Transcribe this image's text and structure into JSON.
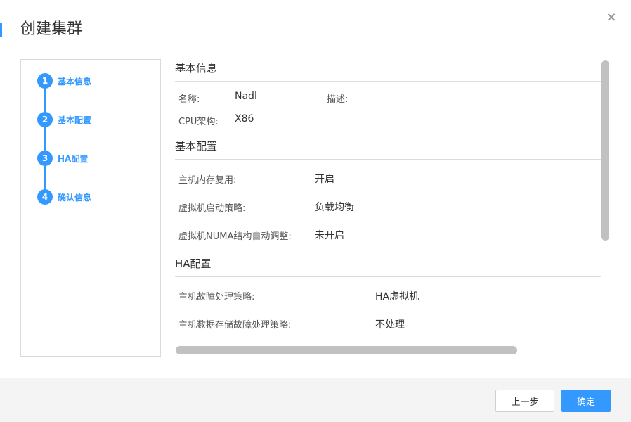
{
  "dialog": {
    "title": "创建集群",
    "close_icon": "×"
  },
  "steps": [
    {
      "num": "1",
      "label": "基本信息"
    },
    {
      "num": "2",
      "label": "基本配置"
    },
    {
      "num": "3",
      "label": "HA配置"
    },
    {
      "num": "4",
      "label": "确认信息"
    }
  ],
  "basic_info": {
    "title": "基本信息",
    "name_label": "名称:",
    "name_value": "Nadl",
    "desc_label": "描述:",
    "desc_value": "",
    "cpu_label": "CPU架构:",
    "cpu_value": "X86"
  },
  "basic_config": {
    "title": "基本配置",
    "rows": [
      {
        "label": "主机内存复用:",
        "value": "开启"
      },
      {
        "label": "虚拟机启动策略:",
        "value": "负载均衡"
      },
      {
        "label": "虚拟机NUMA结构自动调整:",
        "value": "未开启"
      }
    ]
  },
  "ha_config": {
    "title": "HA配置",
    "rows": [
      {
        "label": "主机故障处理策略:",
        "value": "HA虚拟机"
      },
      {
        "label": "主机数据存储故障处理策略:",
        "value": "不处理"
      }
    ]
  },
  "footer": {
    "prev_label": "上一步",
    "ok_label": "确定"
  },
  "colors": {
    "accent": "#3399ff",
    "scrollbar": "#c1c1c1"
  }
}
